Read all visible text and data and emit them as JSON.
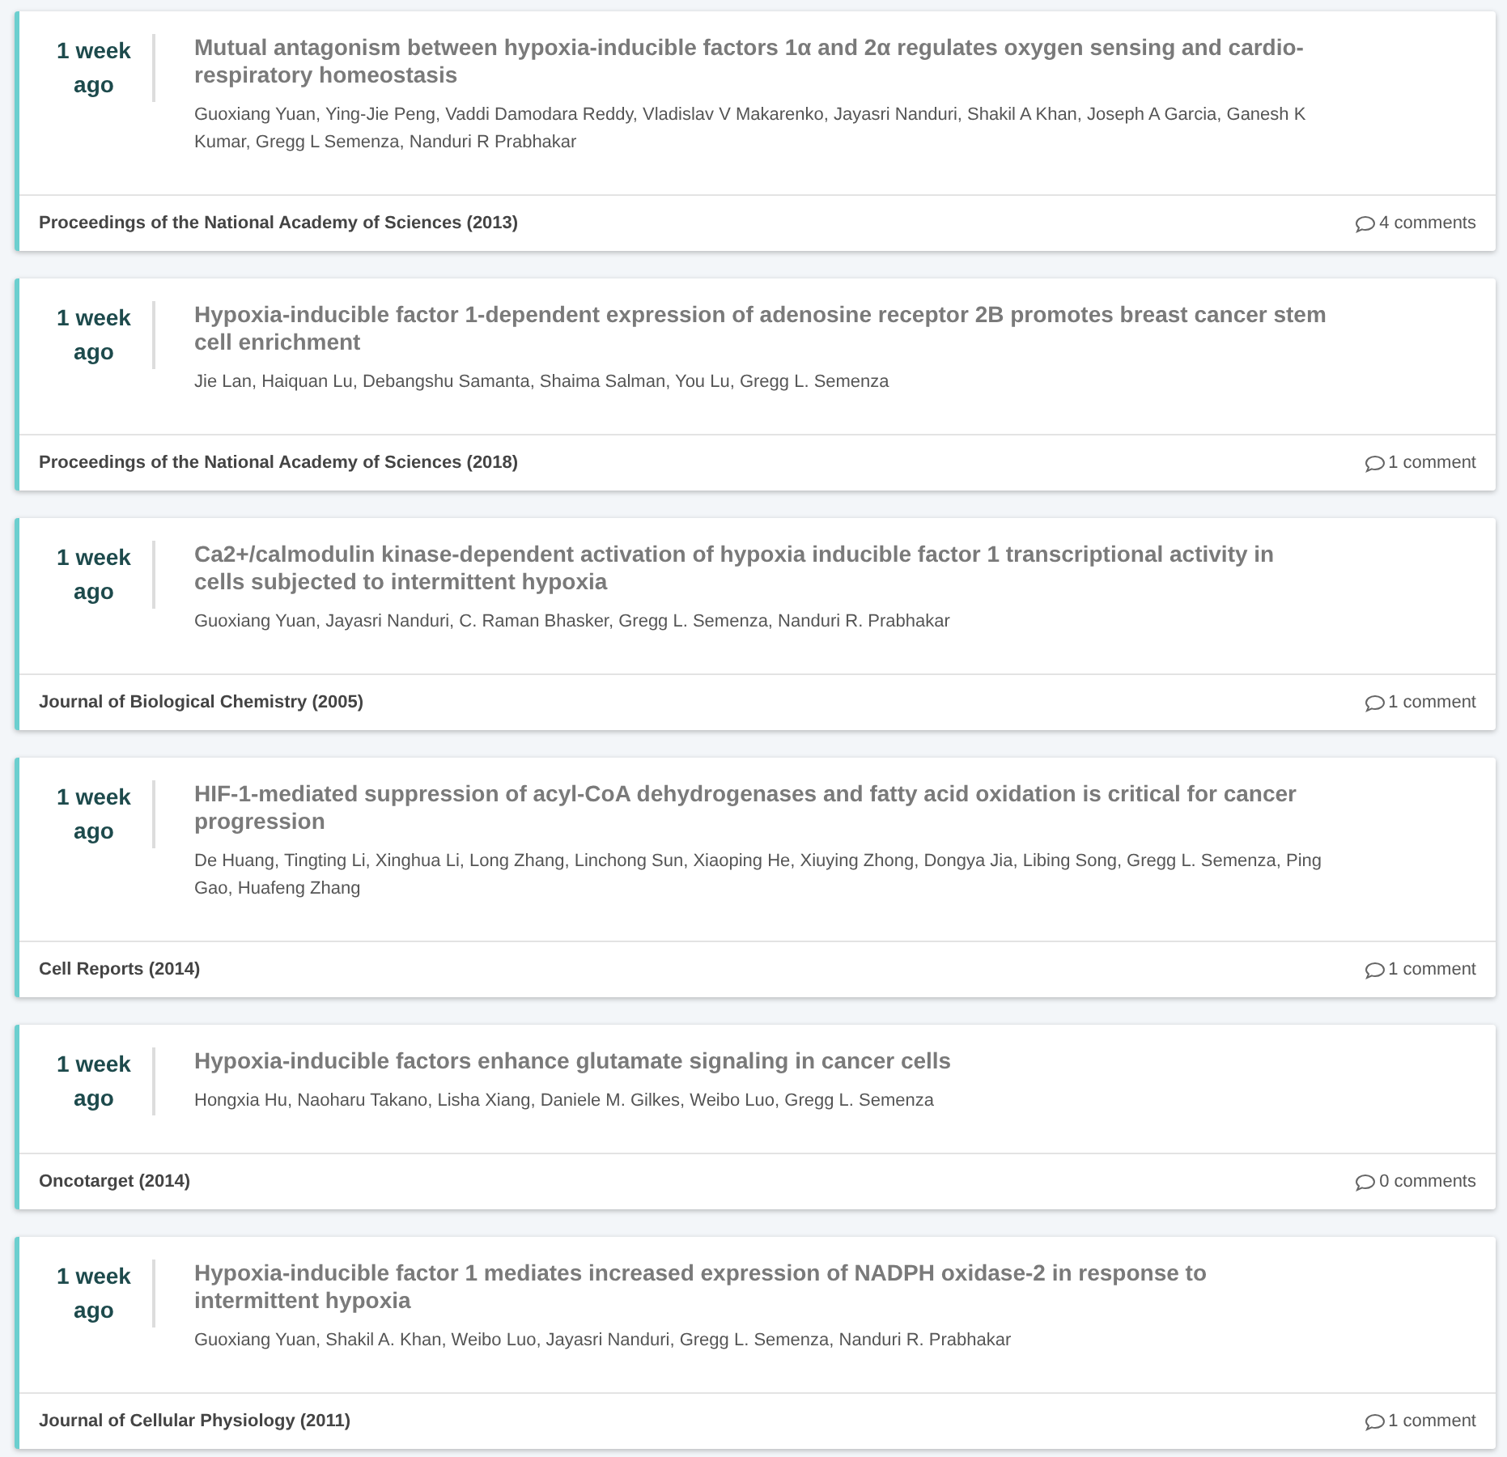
{
  "papers": [
    {
      "time": [
        "1 week",
        "ago"
      ],
      "title": "Mutual antagonism between hypoxia-inducible factors 1α and 2α regulates oxygen sensing and cardio-respiratory homeostasis",
      "authors": "Guoxiang Yuan, Ying-Jie Peng, Vaddi Damodara Reddy, Vladislav V Makarenko, Jayasri Nanduri, Shakil A Khan, Joseph A Garcia, Ganesh K Kumar, Gregg L Semenza, Nanduri R Prabhakar",
      "journal": "Proceedings of the National Academy of Sciences (2013)",
      "comments": "4 comments"
    },
    {
      "time": [
        "1 week",
        "ago"
      ],
      "title": "Hypoxia-inducible factor 1-dependent expression of adenosine receptor 2B promotes breast cancer stem cell enrichment",
      "authors": "Jie Lan, Haiquan Lu, Debangshu Samanta, Shaima Salman, You Lu, Gregg L. Semenza",
      "journal": "Proceedings of the National Academy of Sciences (2018)",
      "comments": "1 comment"
    },
    {
      "time": [
        "1 week",
        "ago"
      ],
      "title": "Ca2+/calmodulin kinase-dependent activation of hypoxia inducible factor 1 transcriptional activity in cells subjected to intermittent hypoxia",
      "authors": "Guoxiang Yuan, Jayasri Nanduri, C. Raman Bhasker, Gregg L. Semenza, Nanduri R. Prabhakar",
      "journal": "Journal of Biological Chemistry (2005)",
      "comments": "1 comment"
    },
    {
      "time": [
        "1 week",
        "ago"
      ],
      "title": "HIF-1-mediated suppression of acyl-CoA dehydrogenases and fatty acid oxidation is critical for cancer progression",
      "authors": "De Huang, Tingting Li, Xinghua Li, Long Zhang, Linchong Sun, Xiaoping He, Xiuying Zhong, Dongya Jia, Libing Song, Gregg L. Semenza, Ping Gao, Huafeng Zhang",
      "journal": "Cell Reports (2014)",
      "comments": "1 comment"
    },
    {
      "time": [
        "1 week",
        "ago"
      ],
      "title": "Hypoxia-inducible factors enhance glutamate signaling in cancer cells",
      "authors": "Hongxia Hu, Naoharu Takano, Lisha Xiang, Daniele M. Gilkes, Weibo Luo, Gregg L. Semenza",
      "journal": "Oncotarget (2014)",
      "comments": "0 comments"
    },
    {
      "time": [
        "1 week",
        "ago"
      ],
      "title": "Hypoxia-inducible factor 1 mediates increased expression of NADPH oxidase-2 in response to intermittent hypoxia",
      "authors": "Guoxiang Yuan, Shakil A. Khan, Weibo Luo, Jayasri Nanduri, Gregg L. Semenza, Nanduri R. Prabhakar",
      "journal": "Journal of Cellular Physiology (2011)",
      "comments": "1 comment"
    }
  ]
}
